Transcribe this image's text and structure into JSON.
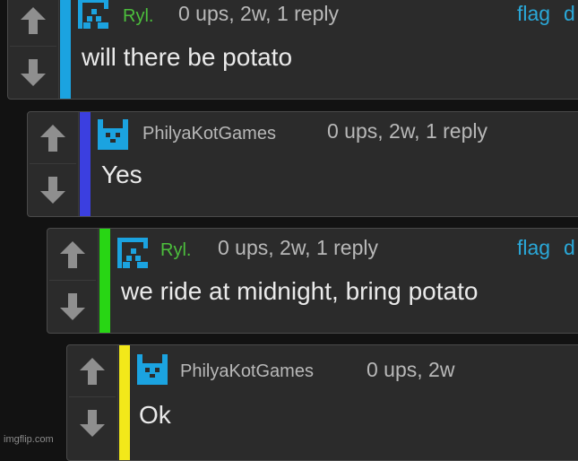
{
  "comments": [
    {
      "username": "Ryl.",
      "user_color": "#4cbf3c",
      "meta": "0 ups, 2w, 1 reply",
      "flag": "flag",
      "extra": "d",
      "text": "will there be potato",
      "bar_color": "#1ba3e0"
    },
    {
      "username": "PhilyaKotGames",
      "user_color": "#b8b8b8",
      "meta": "0 ups, 2w, 1 reply",
      "text": "Yes",
      "bar_color": "#3b3fe0"
    },
    {
      "username": "Ryl.",
      "user_color": "#4cbf3c",
      "meta": "0 ups, 2w, 1 reply",
      "flag": "flag",
      "extra": "d",
      "text": "we ride at midnight, bring potato",
      "bar_color": "#28d614"
    },
    {
      "username": "PhilyaKotGames",
      "user_color": "#b8b8b8",
      "meta": "0 ups, 2w",
      "text": "Ok",
      "bar_color": "#f2e81a"
    }
  ],
  "watermark": "imgflip.com",
  "icons": {
    "upvote": "arrow-up-icon",
    "downvote": "arrow-down-icon",
    "avatar_ryl": "pixel-avatar-icon",
    "avatar_philya": "pixel-cat-avatar-icon"
  }
}
